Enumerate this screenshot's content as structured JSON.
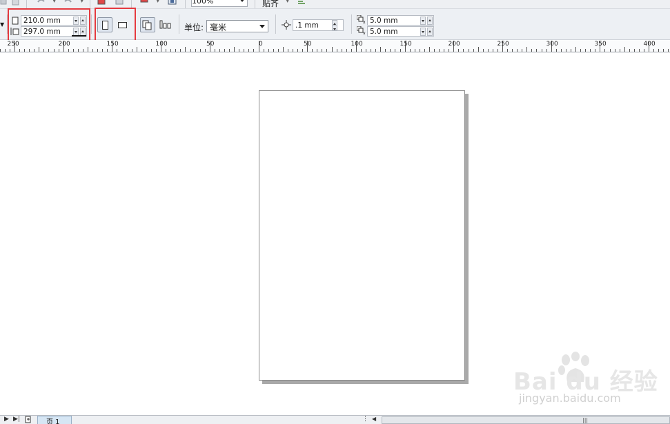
{
  "toolbar": {
    "zoom_level": "100%",
    "snap_label": "贴齐"
  },
  "property_bar": {
    "page_width": "210.0 mm",
    "page_height": "297.0 mm",
    "unit_label": "单位:",
    "unit_value": "毫米",
    "nudge_distance": ".1 mm",
    "duplicate_x": "5.0 mm",
    "duplicate_y": "5.0 mm",
    "highlight_color": "#e5393f"
  },
  "ruler": {
    "labels": [
      "250",
      "200",
      "150",
      "100",
      "50",
      "0",
      "50",
      "100",
      "150",
      "200",
      "250",
      "300",
      "350",
      "400"
    ]
  },
  "page_nav": {
    "page_tab_label": "页 1"
  },
  "watermark": {
    "logo": "Bai du 经验",
    "url": "jingyan.baidu.com"
  }
}
